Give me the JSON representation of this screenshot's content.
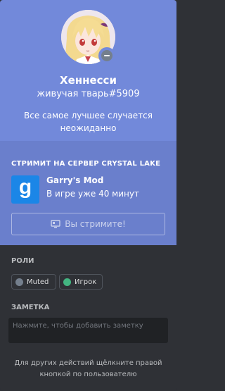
{
  "profile": {
    "username": "Хеннесси",
    "tag": "живучая тварь#5909",
    "custom_status": "Все самое лучшее случается неожиданно",
    "status_color": "#747f8d",
    "header_color": "#7289da"
  },
  "activity": {
    "label": "СТРИМИТ НА СЕРВЕР CRYSTAL LAKE",
    "game_icon_letter": "g",
    "game_icon_color": "#1b86e7",
    "game_name": "Garry's Mod",
    "game_time": "В игре уже 40 минут",
    "stream_button_label": "Вы стримите!",
    "background_color": "#6a7fcc"
  },
  "roles": {
    "label": "РОЛИ",
    "items": [
      {
        "name": "Muted",
        "color": "#747f8d"
      },
      {
        "name": "Игрок",
        "color": "#43b581"
      }
    ]
  },
  "note": {
    "label": "ЗАМЕТКА",
    "placeholder": "Нажмите, чтобы добавить заметку"
  },
  "footer": {
    "hint": "Для других действий щёлкните правой кнопкой по пользователю"
  }
}
